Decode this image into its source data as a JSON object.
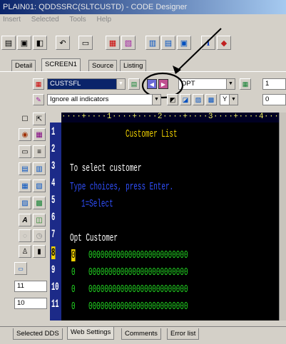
{
  "window": {
    "title": "PLAIN01: QDDSSRC(SLTCUSTD) - CODE Designer"
  },
  "menu": [
    "Insert",
    "Selected",
    "Tools",
    "Help"
  ],
  "tabs": {
    "detail": "Detail",
    "screen1": "SCREEN1",
    "source": "Source",
    "listing": "Listing"
  },
  "format_combo": {
    "value": "CUSTSFL"
  },
  "field_combo": {
    "value": "OPT"
  },
  "indicator_combo": {
    "value": "Ignore all indicators"
  },
  "indicator_small": {
    "value": "Y"
  },
  "spinner_top": {
    "value": "1"
  },
  "spinner_bottom": {
    "value": "0"
  },
  "ruler": {
    "text": "····+····1····+····2····+····3····+····4···"
  },
  "line_numbers": [
    "1",
    "2",
    "3",
    "4",
    "5",
    "6",
    "7",
    "8",
    "9",
    "10",
    "11"
  ],
  "screen": {
    "title": "Customer List",
    "l3": "To select customer",
    "l4": "Type choices, press Enter.",
    "l5": "1=Select",
    "l7": "Opt Customer",
    "opt_char": "0",
    "data": "0000000000000000000000000"
  },
  "spin_a": {
    "value": "11"
  },
  "spin_b": {
    "value": "10"
  },
  "bottom_tabs": {
    "selected_dds": "Selected DDS",
    "web": "Web Settings",
    "comments": "Comments",
    "errors": "Error list"
  },
  "icons": [
    "save-icon",
    "open-icon",
    "undo-icon",
    "properties-icon",
    "left-arrow-icon",
    "right-arrow-icon"
  ],
  "colors": {
    "screen_bg": "#000000",
    "green": "#22d822",
    "yellow": "#f0d000",
    "blue": "#3050ff",
    "white": "#ffffff"
  }
}
